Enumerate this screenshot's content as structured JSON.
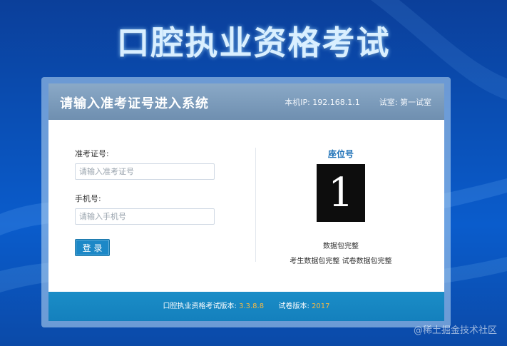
{
  "page": {
    "title": "口腔执业资格考试"
  },
  "header": {
    "title": "请输入准考证号进入系统",
    "ip_label": "本机IP:",
    "ip_value": "192.168.1.1",
    "room_label": "试室:",
    "room_value": "第一试室"
  },
  "form": {
    "ticket_label": "准考证号:",
    "ticket_placeholder": "请输入准考证号",
    "ticket_value": "",
    "phone_label": "手机号:",
    "phone_placeholder": "请输入手机号",
    "phone_value": "",
    "login_label": "登 录"
  },
  "seat": {
    "title": "座位号",
    "number": "1",
    "status_line1": "数据包完整",
    "status_line2": "考生数据包完整 试卷数据包完整"
  },
  "footer": {
    "version_label": "口腔执业资格考试版本:",
    "version_value": "3.3.8.8",
    "paper_label": "试卷版本:",
    "paper_value": "2017"
  },
  "watermark": "@稀土掘金技术社区",
  "colors": {
    "accent": "#1c88c7",
    "footer_value": "#f5b942",
    "header_bg": "#7c9cbd"
  }
}
